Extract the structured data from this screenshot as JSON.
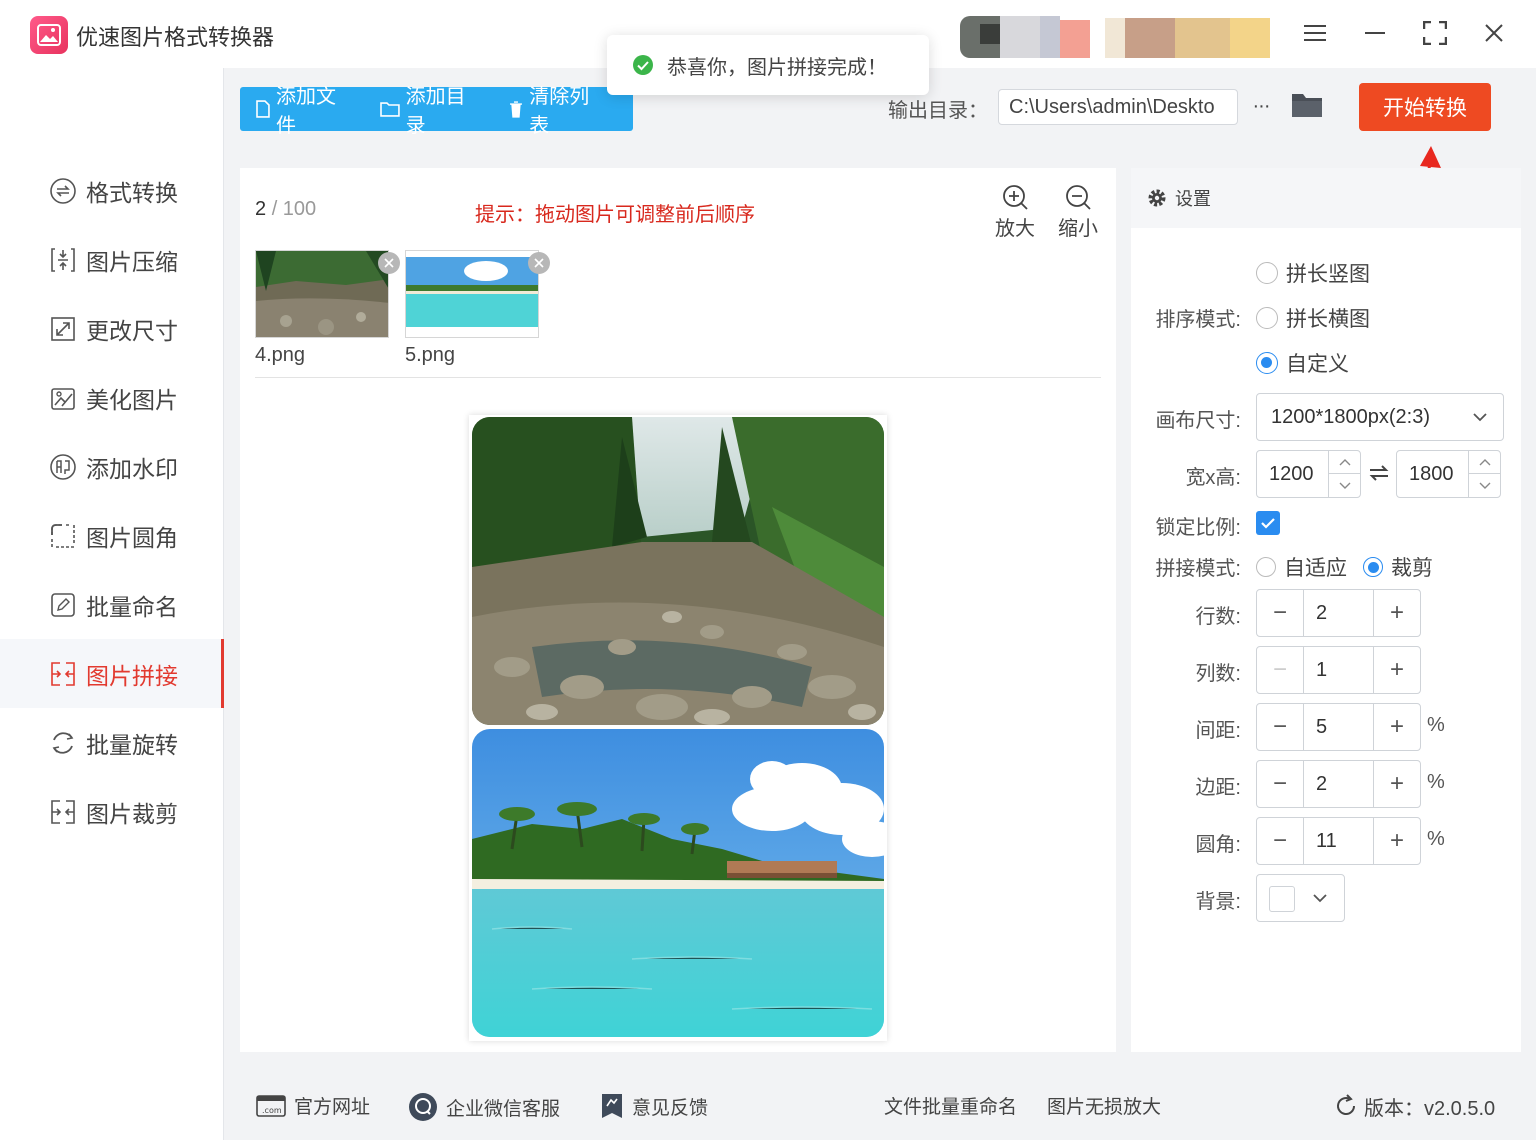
{
  "app": {
    "title": "优速图片格式转换器"
  },
  "toast": {
    "message": "恭喜你，图片拼接完成！"
  },
  "sidebar": {
    "items": [
      {
        "label": "格式转换",
        "icon": "format-convert-icon",
        "active": false
      },
      {
        "label": "图片压缩",
        "icon": "compress-icon",
        "active": false
      },
      {
        "label": "更改尺寸",
        "icon": "resize-icon",
        "active": false
      },
      {
        "label": "美化图片",
        "icon": "beautify-icon",
        "active": false
      },
      {
        "label": "添加水印",
        "icon": "watermark-icon",
        "active": false
      },
      {
        "label": "图片圆角",
        "icon": "rounded-corner-icon",
        "active": false
      },
      {
        "label": "批量命名",
        "icon": "rename-icon",
        "active": false
      },
      {
        "label": "图片拼接",
        "icon": "stitch-icon",
        "active": true
      },
      {
        "label": "批量旋转",
        "icon": "rotate-icon",
        "active": false
      },
      {
        "label": "图片裁剪",
        "icon": "crop-icon",
        "active": false
      }
    ]
  },
  "toolbar": {
    "add_file": "添加文件",
    "add_folder": "添加目录",
    "clear_list": "清除列表",
    "output_label": "输出目录：",
    "output_path": "C:\\Users\\admin\\Deskto",
    "more": "···",
    "start": "开始转换"
  },
  "main": {
    "count_current": "2",
    "count_total": "/ 100",
    "hint": "提示：拖动图片可调整前后顺序",
    "zoom_in": "放大",
    "zoom_out": "缩小",
    "files": [
      {
        "name": "4.png"
      },
      {
        "name": "5.png"
      }
    ]
  },
  "settings": {
    "title": "设置",
    "sort_mode_label": "排序模式:",
    "sort_options": [
      {
        "label": "拼长竖图",
        "checked": false
      },
      {
        "label": "拼长横图",
        "checked": false
      },
      {
        "label": "自定义",
        "checked": true
      }
    ],
    "canvas_label": "画布尺寸:",
    "canvas_value": "1200*1800px(2:3)",
    "wh_label": "宽x高:",
    "width": "1200",
    "height": "1800",
    "lock_label": "锁定比例:",
    "lock_checked": true,
    "stitch_mode_label": "拼接模式:",
    "stitch_options": [
      {
        "label": "自适应",
        "checked": false
      },
      {
        "label": "裁剪",
        "checked": true
      }
    ],
    "rows_label": "行数:",
    "rows": "2",
    "cols_label": "列数:",
    "cols": "1",
    "spacing_label": "间距:",
    "spacing": "5",
    "margin_label": "边距:",
    "margin": "2",
    "radius_label": "圆角:",
    "radius": "11",
    "percent": "%",
    "background_label": "背景:",
    "background_color": "#ffffff"
  },
  "footer": {
    "official_site": "官方网址",
    "wechat_service": "企业微信客服",
    "feedback": "意见反馈",
    "batch_rename": "文件批量重命名",
    "lossless_upscale": "图片无损放大",
    "version_label": "版本：",
    "version": "v2.0.5.0"
  },
  "colors": {
    "accent_blue": "#2aaaf0",
    "start_orange": "#ee4a22",
    "active_red": "#e23a2f",
    "radio_blue": "#2a8cf0"
  }
}
